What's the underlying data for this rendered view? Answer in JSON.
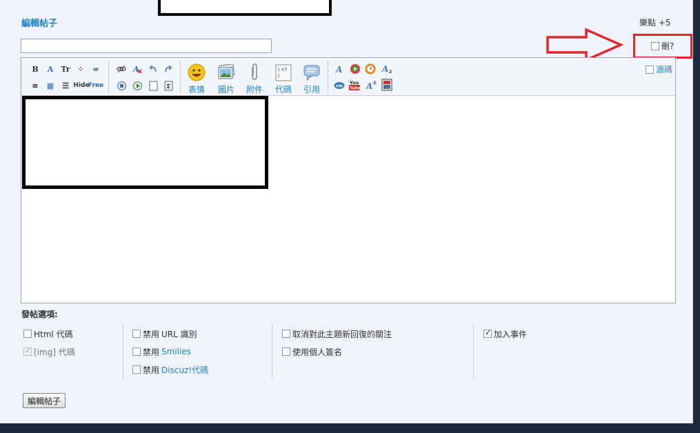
{
  "title": "編輯帖子",
  "credits": "樂點 +5",
  "subject": {
    "value": "",
    "placeholder": ""
  },
  "delete_option": {
    "label": "刪?",
    "checked": false
  },
  "editor": {
    "source_label": "源碼",
    "source_checked": false,
    "toolbar": {
      "small_row1": [
        "B",
        "A",
        "Tr",
        "⁘",
        "∞"
      ],
      "small_row2": [
        "≡",
        "▦",
        "☰",
        "Hide",
        "Free"
      ],
      "big_buttons": [
        {
          "label": "表情",
          "icon": "smiley-icon"
        },
        {
          "label": "圖片",
          "icon": "image-icon"
        },
        {
          "label": "附件",
          "icon": "paperclip-icon"
        },
        {
          "label": "代碼",
          "icon": "code-icon"
        },
        {
          "label": "引用",
          "icon": "quote-icon"
        }
      ]
    },
    "content": ""
  },
  "options": {
    "title": "發帖選項:",
    "col1": [
      {
        "label": "Html 代碼",
        "checked": false,
        "disabled": false
      },
      {
        "label": "[img] 代碼",
        "checked": true,
        "disabled": true
      }
    ],
    "col2": [
      {
        "prefix": "禁用 ",
        "label": "URL 識別",
        "linked": false,
        "checked": false
      },
      {
        "prefix": "禁用 ",
        "label": "Smilies",
        "linked": true,
        "checked": false
      },
      {
        "prefix": "禁用 ",
        "label": "Discuz!代碼",
        "linked": true,
        "checked": false
      }
    ],
    "col3": [
      {
        "label": "取消對此主題新回復的關注",
        "checked": false
      },
      {
        "label": "使用個人簽名",
        "checked": false
      }
    ],
    "col4": [
      {
        "label": "加入事件",
        "checked": true
      }
    ]
  },
  "submit_label": "編輯帖子",
  "colors": {
    "accent": "#1f86c4",
    "highlight_red": "#e0262a"
  }
}
